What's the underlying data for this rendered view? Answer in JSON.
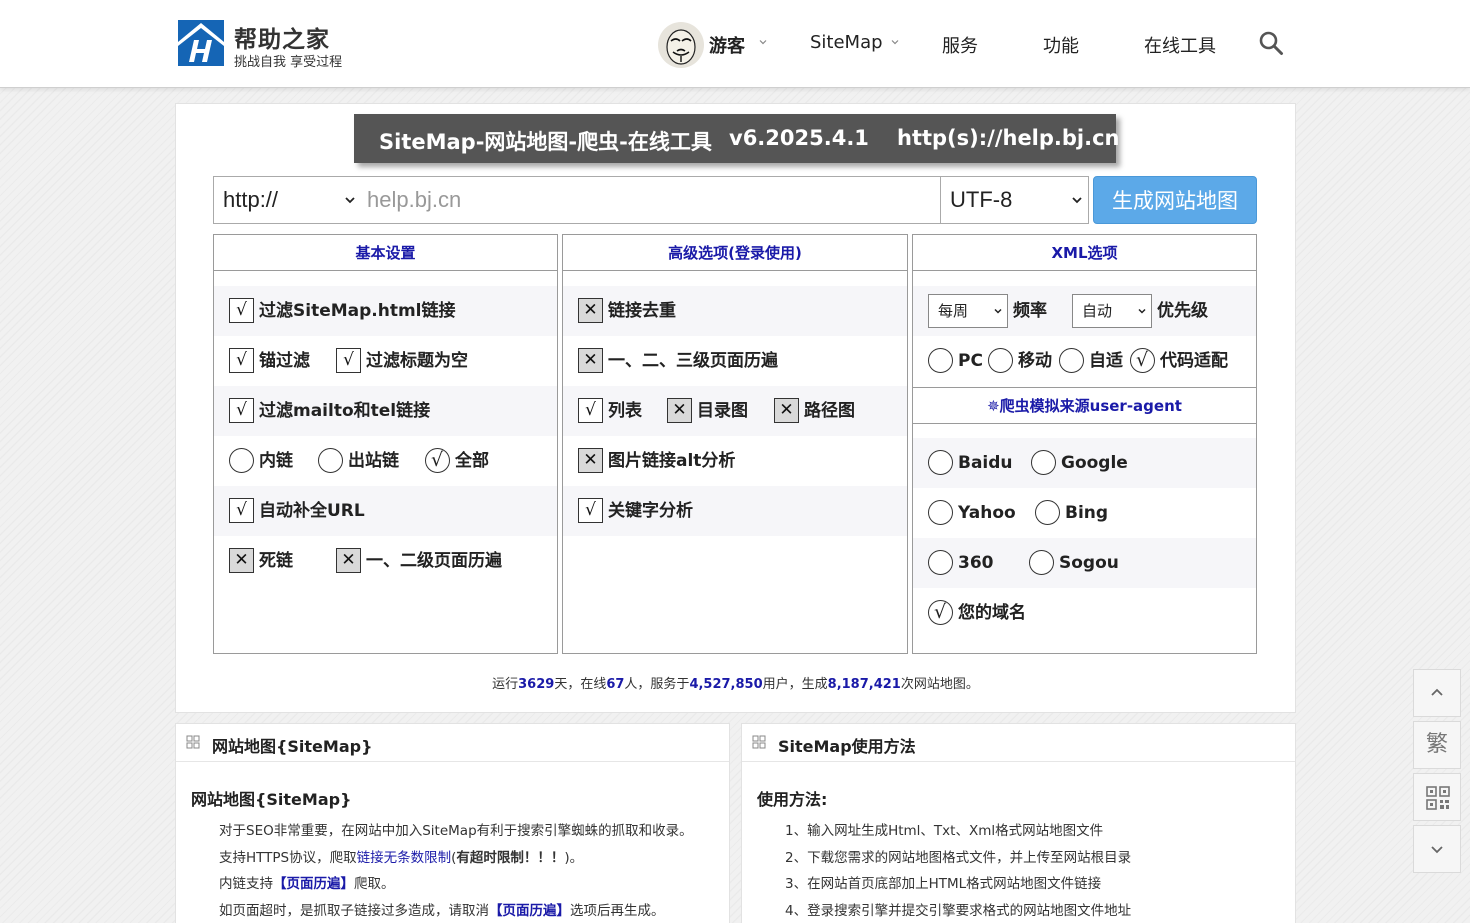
{
  "header": {
    "brand_name": "帮助之家",
    "brand_slogan": "挑战自我 享受过程",
    "user_label": "游客",
    "nav": [
      "SiteMap",
      "服务",
      "功能",
      "在线工具"
    ]
  },
  "tool": {
    "title": "SiteMap-网站地图-爬虫-在线工具",
    "version": "v6.2025.4.1",
    "site": "http(s)://help.bj.cn",
    "protocol": "http://",
    "url_placeholder": "help.bj.cn",
    "encoding": "UTF-8",
    "generate_label": "生成网站地图"
  },
  "basic": {
    "heading": "基本设置",
    "filter_sitemap_html": "过滤SiteMap.html链接",
    "anchor_filter": "锚过滤",
    "filter_empty_title": "过滤标题为空",
    "filter_mailto_tel": "过滤mailto和tel链接",
    "internal": "内链",
    "outbound": "出站链",
    "all": "全部",
    "auto_complete_url": "自动补全URL",
    "dead_links": "死链",
    "level12_traverse": "一、二级页面历遍"
  },
  "advanced": {
    "heading": "高级选项(登录使用)",
    "dedupe": "链接去重",
    "level123_traverse": "一、二、三级页面历遍",
    "list": "列表",
    "directory_map": "目录图",
    "path_map": "路径图",
    "img_alt": "图片链接alt分析",
    "keyword": "关键字分析"
  },
  "xml": {
    "heading": "XML选项",
    "freq_value": "每周",
    "freq_label": "频率",
    "priority_value": "自动",
    "priority_label": "优先级",
    "pc": "PC",
    "mobile": "移动",
    "adaptive": "自适",
    "code_adapt": "代码适配"
  },
  "ua": {
    "heading": "爬虫模拟来源user-agent",
    "heading_icon": "spider-icon",
    "baidu": "Baidu",
    "google": "Google",
    "yahoo": "Yahoo",
    "bing": "Bing",
    "n360": "360",
    "sogou": "Sogou",
    "your_domain": "您的域名"
  },
  "stats": {
    "t1": "运行",
    "days": "3629",
    "t2": "天，在线",
    "online": "67",
    "t3": "人，服务于",
    "users": "4,527,850",
    "t4": "用户，生成",
    "maps": "8,187,421",
    "t5": "次网站地图。"
  },
  "left_panel": {
    "title": "网站地图{SiteMap}",
    "subtitle": "网站地图{SiteMap}",
    "l1": "对于SEO非常重要，在网站中加入SiteMap有利于搜索引擎蜘蛛的抓取和收录。",
    "l2a": "支持HTTPS协议，爬取",
    "l2b": "链接无条数限制",
    "l2c": "(",
    "l2d": "有超时限制！！！",
    "l2e": ")。",
    "l3a": "内链支持",
    "l3b": "【页面历遍】",
    "l3c": "爬取。",
    "l4a": "如页面超时，是抓取子链接过多造成，请取消",
    "l4b": "【页面历遍】",
    "l4c": "选项后再生成。"
  },
  "right_panel": {
    "title": "SiteMap使用方法",
    "subtitle": "使用方法:",
    "steps": [
      "1、输入网址生成Html、Txt、Xml格式网站地图文件",
      "2、下载您需求的网站地图格式文件，并上传至网站根目录",
      "3、在网站首页底部加上HTML格式网站地图文件链接",
      "4、登录搜索引擎并提交引擎要求格式的网站地图文件地址"
    ]
  },
  "side": {
    "traditional": "繁"
  },
  "colors": {
    "accent_blue": "#1a1aa8",
    "button_blue": "#5ca9e8",
    "banner_gray": "#555555"
  }
}
